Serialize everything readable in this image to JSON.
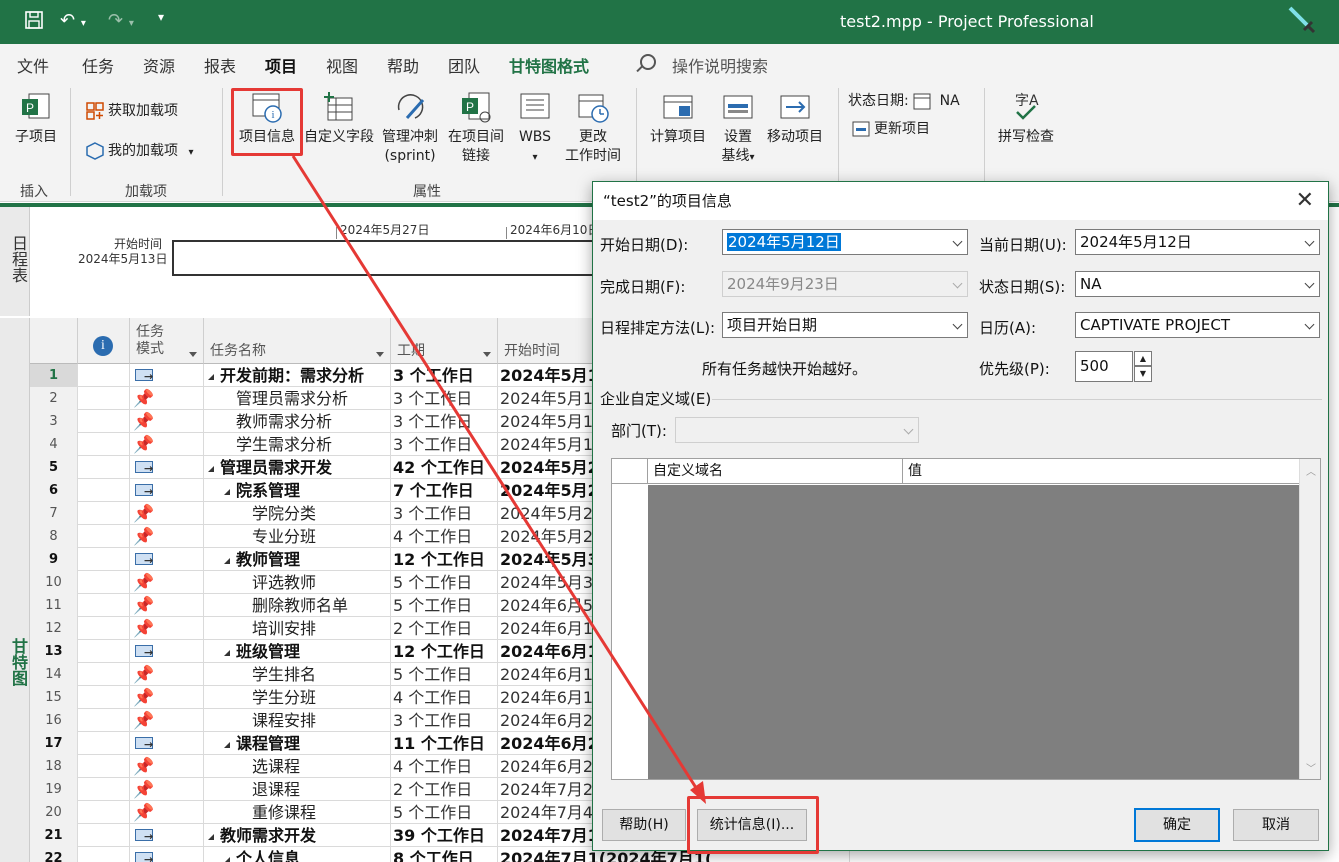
{
  "titlebar": {
    "title": "test2.mpp  -  Project Professional"
  },
  "tabs": [
    "文件",
    "任务",
    "资源",
    "报表",
    "项目",
    "视图",
    "帮助",
    "团队",
    "甘特图格式"
  ],
  "tabs_active": "项目",
  "search_placeholder": "操作说明搜索",
  "ribbon": {
    "subproject": "子项目",
    "get_addins": "获取加载项",
    "my_addins": "我的加载项",
    "project_info": "项目信息",
    "custom_fields": "自定义字段",
    "manage_sprint_1": "管理冲刺",
    "manage_sprint_2": "(sprint)",
    "links_1": "在项目间",
    "links_2": "链接",
    "wbs": "WBS",
    "change_time_1": "更改",
    "change_time_2": "工作时间",
    "calc_project": "计算项目",
    "baseline_1": "设置",
    "baseline_2": "基线",
    "move_project": "移动项目",
    "status_date_label": "状态日期:",
    "status_date_value": "NA",
    "update_project": "更新项目",
    "spelling": "拼写检查",
    "group_insert": "插入",
    "group_addins": "加载项",
    "group_properties": "属性"
  },
  "timeline": {
    "side_label": "日程表",
    "start_label": "开始时间",
    "start_date": "2024年5月13日",
    "tick1": "2024年5月27日",
    "tick2": "2024年6月10日"
  },
  "gantt_side_label": "甘特图",
  "grid": {
    "headers": {
      "mode": "任务模式",
      "name": "任务名称",
      "duration": "工期",
      "start": "开始时间"
    },
    "rows": [
      {
        "id": "1",
        "name": "开发前期：需求分析",
        "dur": "3 个工作日",
        "start": "2024年5月1",
        "summary": true,
        "level": 0
      },
      {
        "id": "2",
        "name": "管理员需求分析",
        "dur": "3 个工作日",
        "start": "2024年5月1",
        "summary": false,
        "level": 1
      },
      {
        "id": "3",
        "name": "教师需求分析",
        "dur": "3 个工作日",
        "start": "2024年5月1",
        "summary": false,
        "level": 1
      },
      {
        "id": "4",
        "name": "学生需求分析",
        "dur": "3 个工作日",
        "start": "2024年5月1",
        "summary": false,
        "level": 1
      },
      {
        "id": "5",
        "name": "管理员需求开发",
        "dur": "42 个工作日",
        "start": "2024年5月2",
        "summary": true,
        "level": 0
      },
      {
        "id": "6",
        "name": "院系管理",
        "dur": "7 个工作日",
        "start": "2024年5月2",
        "summary": true,
        "level": 1
      },
      {
        "id": "7",
        "name": "学院分类",
        "dur": "3 个工作日",
        "start": "2024年5月2",
        "summary": false,
        "level": 2
      },
      {
        "id": "8",
        "name": "专业分班",
        "dur": "4 个工作日",
        "start": "2024年5月2",
        "summary": false,
        "level": 2
      },
      {
        "id": "9",
        "name": "教师管理",
        "dur": "12 个工作日",
        "start": "2024年5月3",
        "summary": true,
        "level": 1
      },
      {
        "id": "10",
        "name": "评选教师",
        "dur": "5 个工作日",
        "start": "2024年5月3",
        "summary": false,
        "level": 2
      },
      {
        "id": "11",
        "name": "删除教师名单",
        "dur": "5 个工作日",
        "start": "2024年6月5",
        "summary": false,
        "level": 2
      },
      {
        "id": "12",
        "name": "培训安排",
        "dur": "2 个工作日",
        "start": "2024年6月1",
        "summary": false,
        "level": 2
      },
      {
        "id": "13",
        "name": "班级管理",
        "dur": "12 个工作日",
        "start": "2024年6月1",
        "summary": true,
        "level": 1
      },
      {
        "id": "14",
        "name": "学生排名",
        "dur": "5 个工作日",
        "start": "2024年6月1",
        "summary": false,
        "level": 2
      },
      {
        "id": "15",
        "name": "学生分班",
        "dur": "4 个工作日",
        "start": "2024年6月1",
        "summary": false,
        "level": 2
      },
      {
        "id": "16",
        "name": "课程安排",
        "dur": "3 个工作日",
        "start": "2024年6月2",
        "summary": false,
        "level": 2
      },
      {
        "id": "17",
        "name": "课程管理",
        "dur": "11 个工作日",
        "start": "2024年6月2",
        "summary": true,
        "level": 1
      },
      {
        "id": "18",
        "name": "选课程",
        "dur": "4 个工作日",
        "start": "2024年6月2",
        "summary": false,
        "level": 2
      },
      {
        "id": "19",
        "name": "退课程",
        "dur": "2 个工作日",
        "start": "2024年7月2",
        "summary": false,
        "level": 2
      },
      {
        "id": "20",
        "name": "重修课程",
        "dur": "5 个工作日",
        "start": "2024年7月4",
        "summary": false,
        "level": 2
      },
      {
        "id": "21",
        "name": "教师需求开发",
        "dur": "39 个工作日",
        "start": "2024年7月1",
        "summary": true,
        "level": 0
      },
      {
        "id": "22",
        "name": "个人信息",
        "dur": "8 个工作日",
        "start": "2024年7月1(2024年7月1(",
        "summary": true,
        "level": 1
      }
    ]
  },
  "dialog": {
    "title": "“test2”的项目信息",
    "start_date_label": "开始日期(D):",
    "start_date_value": "2024年5月12日",
    "current_date_label": "当前日期(U):",
    "current_date_value": "2024年5月12日",
    "finish_date_label": "完成日期(F):",
    "finish_date_value": "2024年9月23日",
    "status_date_label": "状态日期(S):",
    "status_date_value": "NA",
    "schedule_from_label": "日程排定方法(L):",
    "schedule_from_value": "项目开始日期",
    "calendar_label": "日历(A):",
    "calendar_value": "CAPTIVATE PROJECT",
    "note": "所有任务越快开始越好。",
    "priority_label": "优先级(P):",
    "priority_value": "500",
    "enterprise_group": "企业自定义域(E)",
    "dept_label": "部门(T):",
    "col_field_name": "自定义域名",
    "col_value": "值",
    "help_btn": "帮助(H)",
    "stats_btn": "统计信息(I)...",
    "ok_btn": "确定",
    "cancel_btn": "取消"
  },
  "colors": {
    "accent": "#217346",
    "highlight": "#e53935"
  }
}
